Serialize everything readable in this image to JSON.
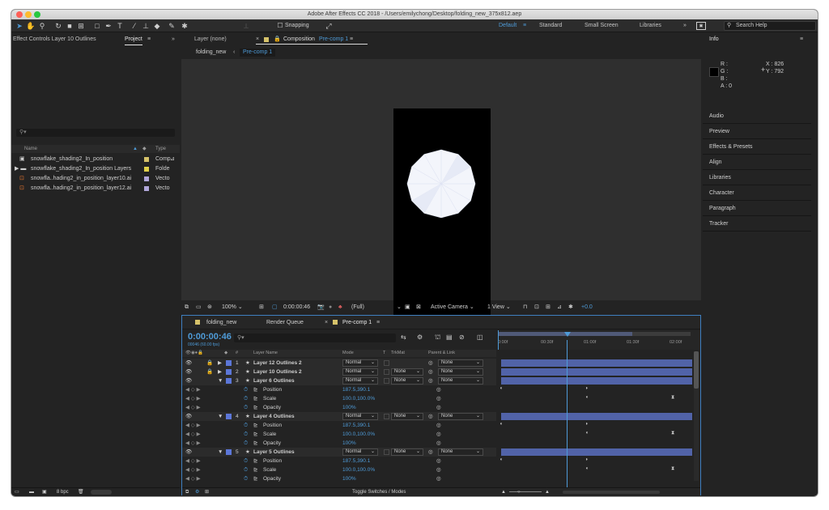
{
  "window": {
    "title": "Adobe After Effects CC 2018 - /Users/emilychong/Desktop/folding_new_375x812.aep"
  },
  "toolbar": {
    "snapping_label": "Snapping",
    "workspaces": [
      "Default",
      "Standard",
      "Small Screen",
      "Libraries"
    ],
    "more": "»",
    "search_placeholder": "Search Help"
  },
  "left_panel": {
    "effect_controls_tab": "Effect Controls Layer 10 Outlines",
    "project_tab": "Project",
    "search_prefix": "⚲▾",
    "columns": {
      "name": "Name",
      "type": "Type"
    },
    "items": [
      {
        "name": "snowflake_shading2_In_position",
        "type": "Comp",
        "color": "#d6c26a"
      },
      {
        "name": "snowflake_shading2_In_position Layers",
        "type": "Folde",
        "color": "#e0d04a"
      },
      {
        "name": "snowfla..hading2_in_position_layer10.ai",
        "type": "Vecto",
        "color": "#b1a7da"
      },
      {
        "name": "snowfla..hading2_in_position_layer12.ai",
        "type": "Vecto",
        "color": "#b1a7da"
      }
    ],
    "bpc": "8 bpc"
  },
  "comp_panel": {
    "tab_layer": "Layer (none)",
    "tab_comp_prefix": "Composition",
    "tab_comp_name": "Pre-comp 1",
    "crumb_root": "folding_new",
    "crumb_current": "Pre-comp 1",
    "zoom": "100%",
    "timecode": "0:00:00:46",
    "resolution": "(Full)",
    "camera": "Active Camera",
    "views": "1 View",
    "exposure": "+0.0"
  },
  "right_panel": {
    "title": "Info",
    "info_labels": [
      "R :",
      "G :",
      "B :",
      "A : 0"
    ],
    "x": "X : 826",
    "y": "Y : 792",
    "panels": [
      "Audio",
      "Preview",
      "Effects & Presets",
      "Align",
      "Libraries",
      "Character",
      "Paragraph",
      "Tracker"
    ]
  },
  "timeline": {
    "tabs": [
      "folding_new",
      "Render Queue",
      "Pre-comp 1"
    ],
    "current_time": "0:00:00:46",
    "fps": "00046 (60.00 fps)",
    "columns": {
      "num": "#",
      "layer_name": "Layer Name",
      "mode": "Mode",
      "t": "T",
      "trkmat": "TrkMat",
      "parent": "Parent & Link"
    },
    "ruler": [
      "0:00f",
      "00:30f",
      "01:00f",
      "01:30f",
      "02:00f"
    ],
    "rows": [
      {
        "kind": "layer",
        "num": "1",
        "name": "Layer 12 Outlines 2",
        "mode": "Normal",
        "trkmat": "",
        "parent": "None",
        "color": "#5c77d8"
      },
      {
        "kind": "layer",
        "num": "2",
        "name": "Layer 10 Outlines 2",
        "mode": "Normal",
        "trkmat": "None",
        "parent": "None",
        "color": "#5c77d8"
      },
      {
        "kind": "layer",
        "num": "3",
        "name": "Layer 6 Outlines",
        "mode": "Normal",
        "trkmat": "None",
        "parent": "None",
        "color": "#5c77d8"
      },
      {
        "kind": "prop",
        "name": "Position",
        "value": "187.5,390.1"
      },
      {
        "kind": "prop",
        "name": "Scale",
        "value": "100.0,100.0%"
      },
      {
        "kind": "prop",
        "name": "Opacity",
        "value": "100%"
      },
      {
        "kind": "layer",
        "num": "4",
        "name": "Layer 4 Outlines",
        "mode": "Normal",
        "trkmat": "None",
        "parent": "None",
        "color": "#5c77d8"
      },
      {
        "kind": "prop",
        "name": "Position",
        "value": "187.5,390.1"
      },
      {
        "kind": "prop",
        "name": "Scale",
        "value": "100.0,100.0%"
      },
      {
        "kind": "prop",
        "name": "Opacity",
        "value": "100%"
      },
      {
        "kind": "layer",
        "num": "5",
        "name": "Layer 5 Outlines",
        "mode": "Normal",
        "trkmat": "None",
        "parent": "None",
        "color": "#5c77d8"
      },
      {
        "kind": "prop",
        "name": "Position",
        "value": "187.5,390.1"
      },
      {
        "kind": "prop",
        "name": "Scale",
        "value": "100.0,100.0%"
      },
      {
        "kind": "prop",
        "name": "Opacity",
        "value": "100%"
      }
    ],
    "toggle_label": "Toggle Switches / Modes"
  },
  "colors": {
    "accent": "#4e9bd8",
    "bar": "#5163a8"
  }
}
